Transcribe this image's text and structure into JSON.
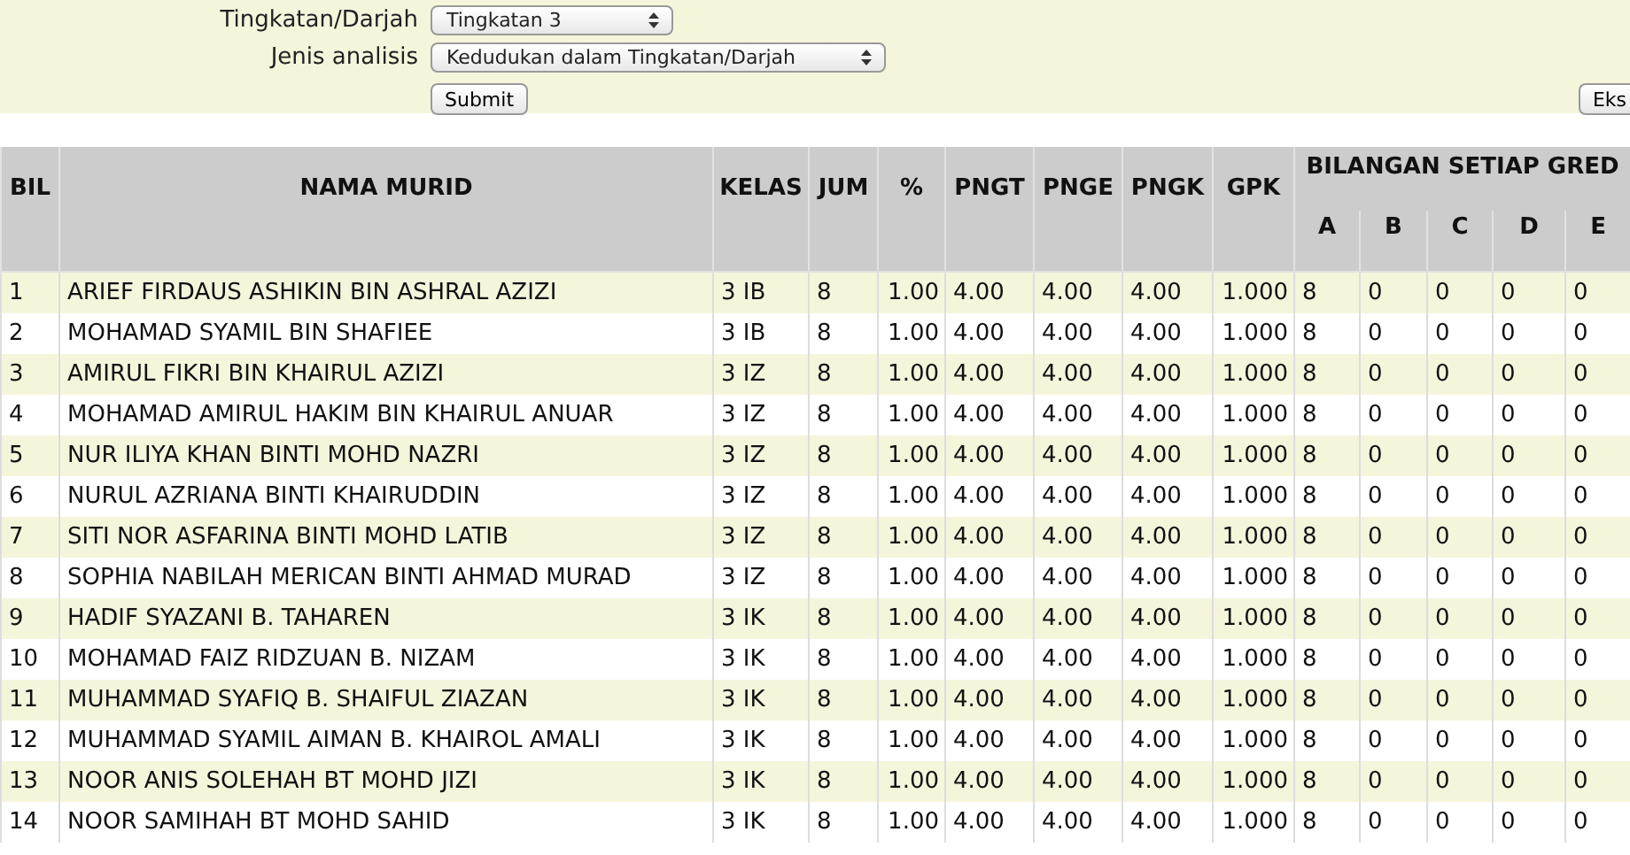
{
  "form": {
    "fields": [
      {
        "label": "Tingkatan/Darjah",
        "value": "Tingkatan 3"
      },
      {
        "label": "Jenis analisis",
        "value": "Kedudukan dalam Tingkatan/Darjah"
      }
    ],
    "submit": "Submit",
    "export": "Eks"
  },
  "table": {
    "columns": [
      "BIL",
      "NAMA MURID",
      "KELAS",
      "JUM",
      "%",
      "PNGT",
      "PNGE",
      "PNGK",
      "GPK"
    ],
    "group": {
      "label": "BILANGAN SETIAP GRED",
      "columns": [
        "A",
        "B",
        "C",
        "D",
        "E"
      ]
    },
    "rows": [
      [
        "1",
        "ARIEF FIRDAUS ASHIKIN BIN ASHRAL AZIZI",
        "3 IB",
        "8",
        "1.00",
        "4.00",
        "4.00",
        "4.00",
        "1.000",
        "8",
        "0",
        "0",
        "0",
        "0"
      ],
      [
        "2",
        "MOHAMAD SYAMIL BIN SHAFIEE",
        "3 IB",
        "8",
        "1.00",
        "4.00",
        "4.00",
        "4.00",
        "1.000",
        "8",
        "0",
        "0",
        "0",
        "0"
      ],
      [
        "3",
        "AMIRUL FIKRI BIN KHAIRUL AZIZI",
        "3 IZ",
        "8",
        "1.00",
        "4.00",
        "4.00",
        "4.00",
        "1.000",
        "8",
        "0",
        "0",
        "0",
        "0"
      ],
      [
        "4",
        "MOHAMAD AMIRUL HAKIM BIN KHAIRUL ANUAR",
        "3 IZ",
        "8",
        "1.00",
        "4.00",
        "4.00",
        "4.00",
        "1.000",
        "8",
        "0",
        "0",
        "0",
        "0"
      ],
      [
        "5",
        "NUR ILIYA KHAN BINTI MOHD NAZRI",
        "3 IZ",
        "8",
        "1.00",
        "4.00",
        "4.00",
        "4.00",
        "1.000",
        "8",
        "0",
        "0",
        "0",
        "0"
      ],
      [
        "6",
        "NURUL AZRIANA BINTI KHAIRUDDIN",
        "3 IZ",
        "8",
        "1.00",
        "4.00",
        "4.00",
        "4.00",
        "1.000",
        "8",
        "0",
        "0",
        "0",
        "0"
      ],
      [
        "7",
        "SITI NOR ASFARINA BINTI MOHD LATIB",
        "3 IZ",
        "8",
        "1.00",
        "4.00",
        "4.00",
        "4.00",
        "1.000",
        "8",
        "0",
        "0",
        "0",
        "0"
      ],
      [
        "8",
        "SOPHIA NABILAH MERICAN BINTI AHMAD MURAD",
        "3 IZ",
        "8",
        "1.00",
        "4.00",
        "4.00",
        "4.00",
        "1.000",
        "8",
        "0",
        "0",
        "0",
        "0"
      ],
      [
        "9",
        "HADIF SYAZANI B. TAHAREN",
        "3 IK",
        "8",
        "1.00",
        "4.00",
        "4.00",
        "4.00",
        "1.000",
        "8",
        "0",
        "0",
        "0",
        "0"
      ],
      [
        "10",
        "MOHAMAD FAIZ RIDZUAN B. NIZAM",
        "3 IK",
        "8",
        "1.00",
        "4.00",
        "4.00",
        "4.00",
        "1.000",
        "8",
        "0",
        "0",
        "0",
        "0"
      ],
      [
        "11",
        "MUHAMMAD SYAFIQ B. SHAIFUL ZIAZAN",
        "3 IK",
        "8",
        "1.00",
        "4.00",
        "4.00",
        "4.00",
        "1.000",
        "8",
        "0",
        "0",
        "0",
        "0"
      ],
      [
        "12",
        "MUHAMMAD SYAMIL AIMAN B. KHAIROL AMALI",
        "3 IK",
        "8",
        "1.00",
        "4.00",
        "4.00",
        "4.00",
        "1.000",
        "8",
        "0",
        "0",
        "0",
        "0"
      ],
      [
        "13",
        "NOOR ANIS SOLEHAH BT MOHD JIZI",
        "3 IK",
        "8",
        "1.00",
        "4.00",
        "4.00",
        "4.00",
        "1.000",
        "8",
        "0",
        "0",
        "0",
        "0"
      ],
      [
        "14",
        "NOOR SAMIHAH BT MOHD SAHID",
        "3 IK",
        "8",
        "1.00",
        "4.00",
        "4.00",
        "4.00",
        "1.000",
        "8",
        "0",
        "0",
        "0",
        "0"
      ]
    ]
  }
}
